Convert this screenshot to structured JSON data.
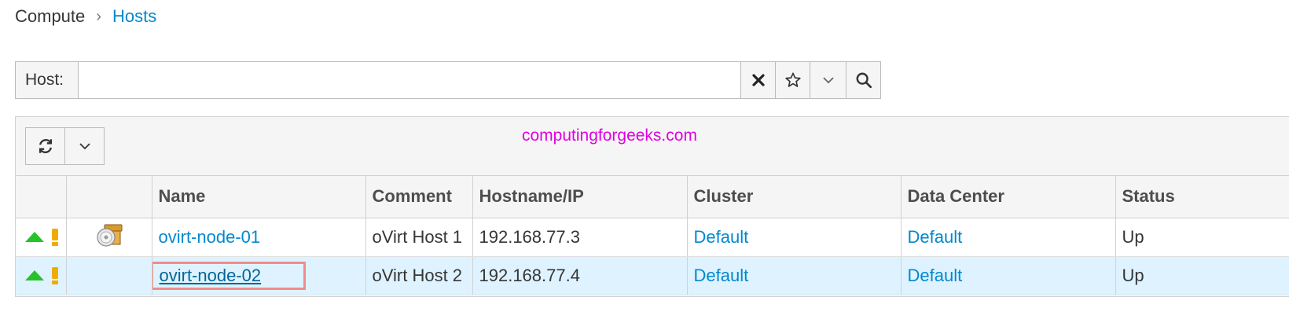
{
  "breadcrumb": {
    "parent": "Compute",
    "current": "Hosts"
  },
  "search": {
    "label": "Host:",
    "value": ""
  },
  "watermark": "computingforgeeks.com",
  "table": {
    "headers": [
      "Name",
      "Comment",
      "Hostname/IP",
      "Cluster",
      "Data Center",
      "Status"
    ],
    "rows": [
      {
        "name": "ovirt-node-01",
        "comment": "oVirt Host 1",
        "hostname": "192.168.77.3",
        "cluster": "Default",
        "datacenter": "Default",
        "status": "Up"
      },
      {
        "name": "ovirt-node-02",
        "comment": "oVirt Host 2",
        "hostname": "192.168.77.4",
        "cluster": "Default",
        "datacenter": "Default",
        "status": "Up"
      }
    ]
  },
  "icons": {
    "status_up": "up-arrow-icon",
    "alert": "exclamation-icon",
    "spm": "spm-server-icon",
    "refresh": "refresh-icon",
    "clear": "close-icon",
    "bookmark": "star-icon",
    "dropdown": "chevron-down-icon",
    "search": "search-icon"
  },
  "colors": {
    "link": "#0088ce",
    "selected_row": "#def3ff",
    "up": "#27c22a",
    "alert": "#f0ab00",
    "highlight_box": "#f28b8b"
  }
}
